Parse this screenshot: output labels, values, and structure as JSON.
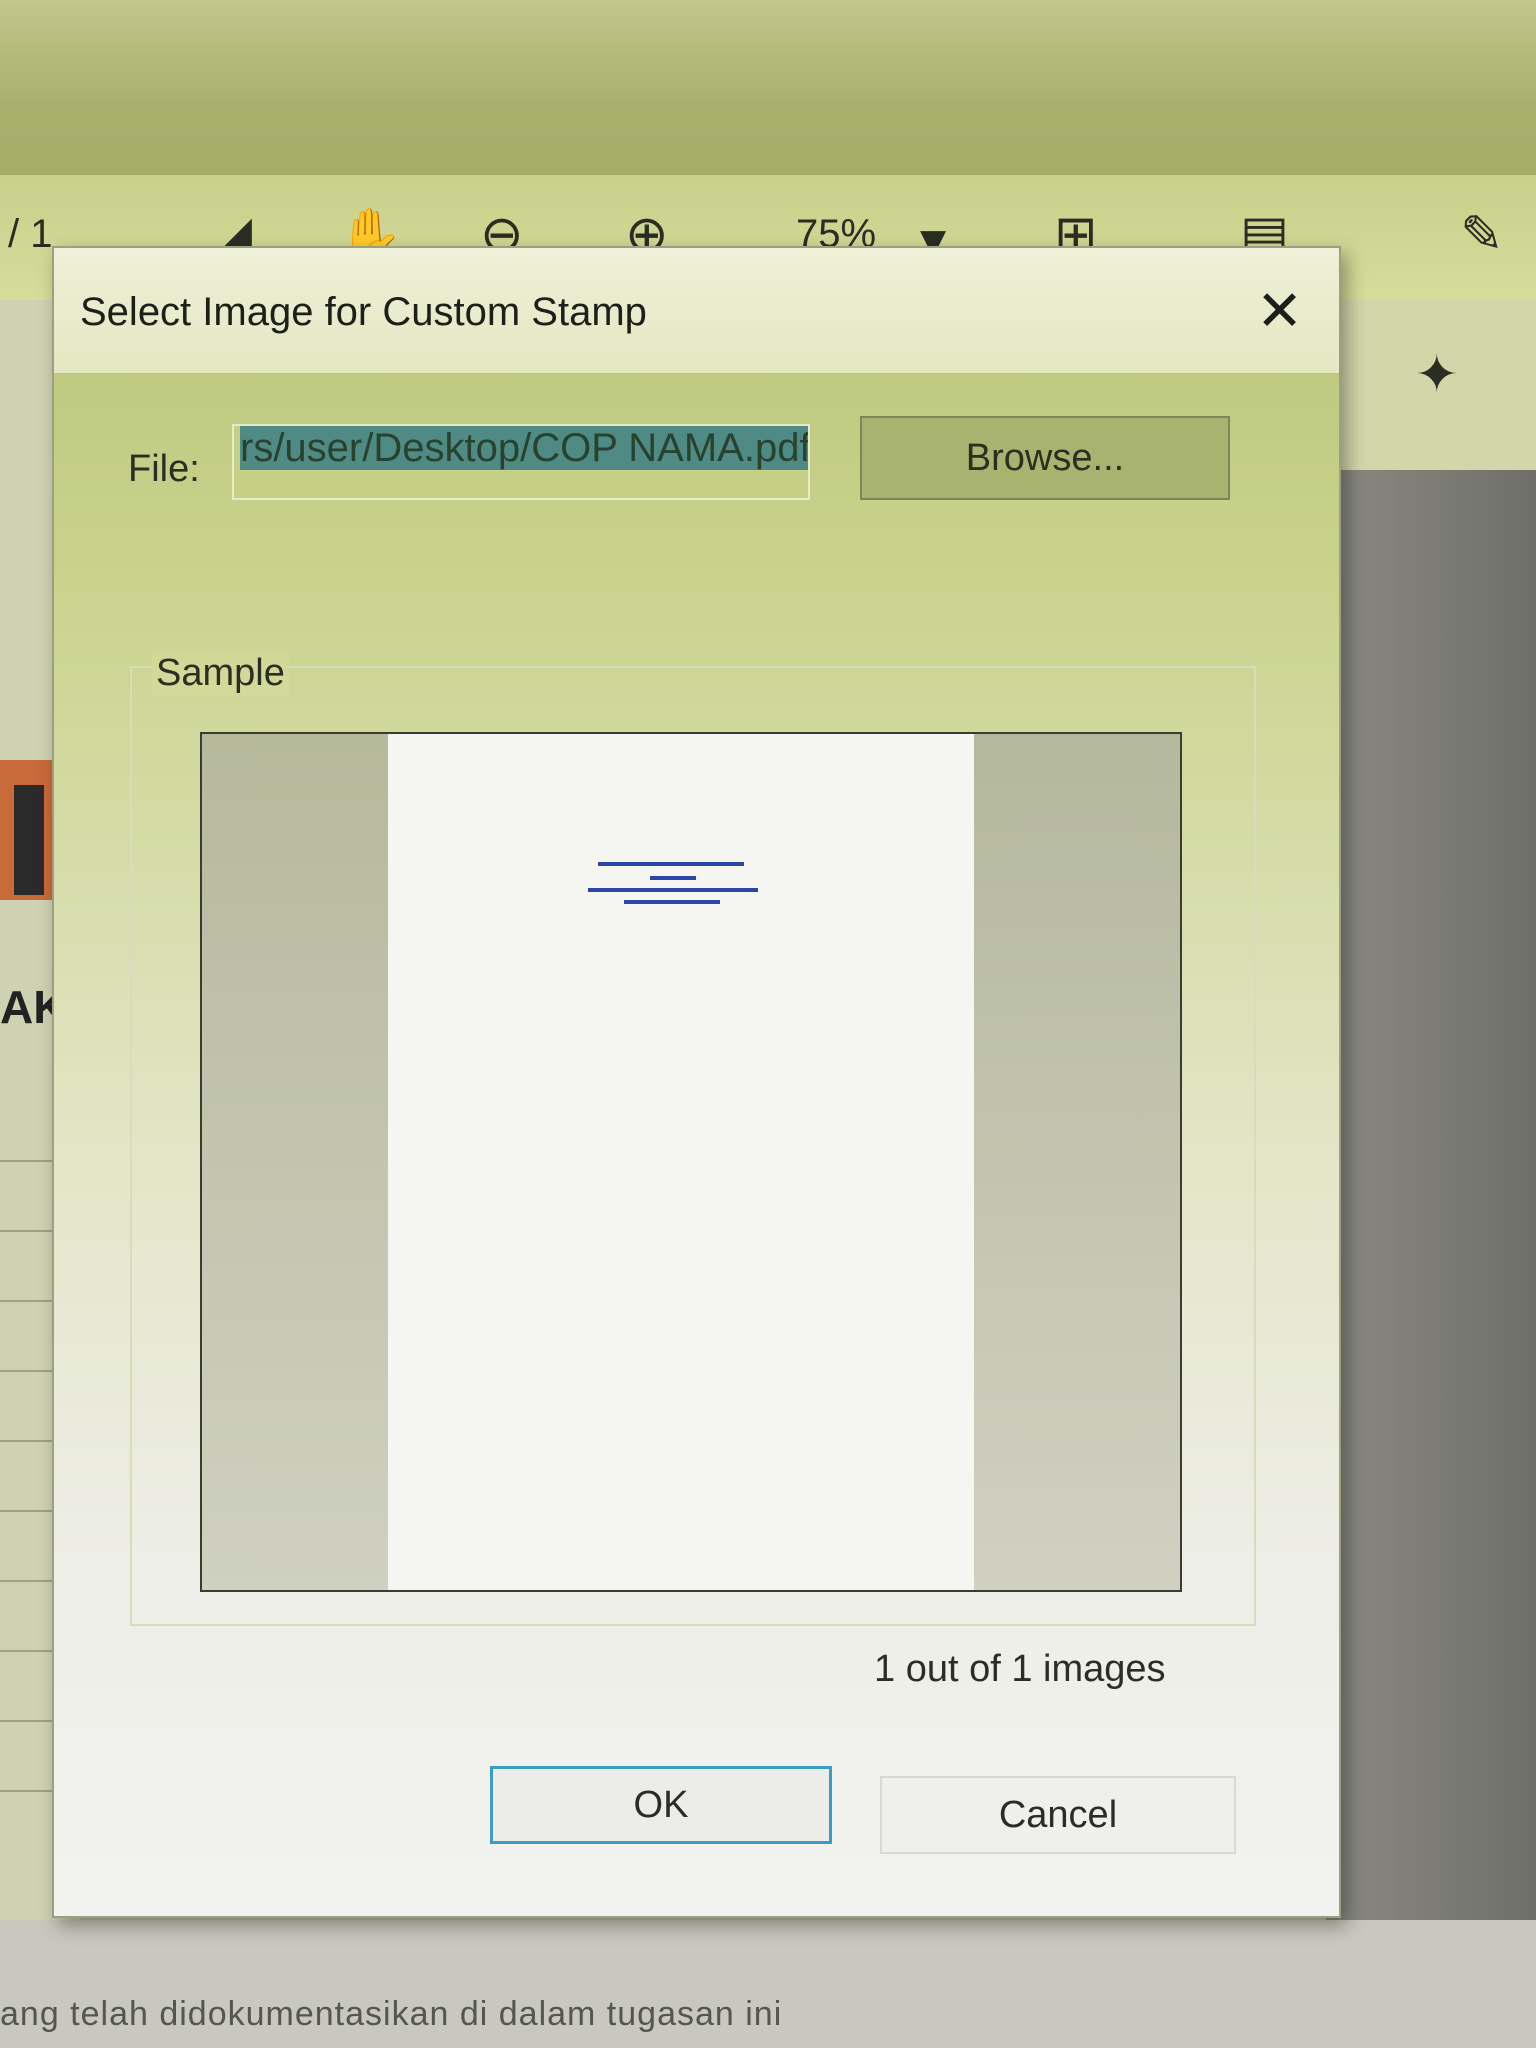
{
  "toolbar": {
    "page_fragment": "/ 1",
    "zoom": "75%",
    "icons": [
      "select-arrow-icon",
      "hand-icon",
      "zoom-out-icon",
      "zoom-in-icon",
      "zoom-dropdown-icon",
      "fit-page-icon",
      "ruler-icon",
      "pen-icon",
      "pin-icon"
    ]
  },
  "background": {
    "left_heading_fragment": "AK",
    "bottom_text": "ang telah didokumentasikan di dalam tugasan ini"
  },
  "dialog": {
    "title": "Select Image for Custom Stamp",
    "file_label": "File:",
    "file_value": "rs/user/Desktop/COP NAMA.pdf",
    "browse_label": "Browse...",
    "sample_label": "Sample",
    "image_count": "1 out of 1 images",
    "ok_label": "OK",
    "cancel_label": "Cancel"
  },
  "colors": {
    "selection": "#4f8a84",
    "ok_focus_border": "#3b9cc4",
    "stamp_text": "#2b46a8"
  }
}
